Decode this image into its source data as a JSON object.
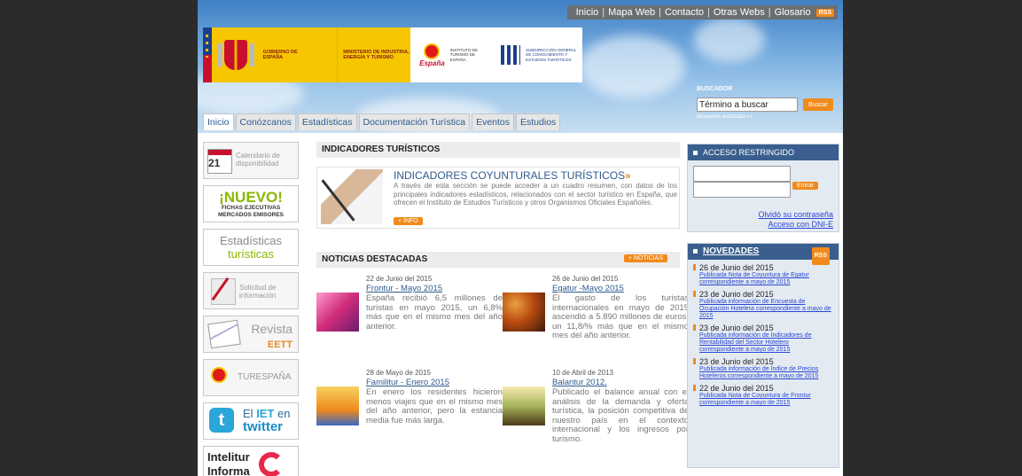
{
  "topbar": {
    "links": [
      "Inicio",
      "Mapa Web",
      "Contacto",
      "Otras Webs",
      "Glosario"
    ],
    "rss": "RSS"
  },
  "header": {
    "gobierno": "GOBIERNO DE ESPAÑA",
    "ministerio": "MINISTERIO DE INDUSTRIA, ENERGÍA Y TURISMO",
    "instituto": "INSTITUTO DE TURISMO DE ESPAÑA",
    "espana_logo": "España",
    "subdireccion": "SUBDIRECCIÓN GENERAL DE CONOCIMIENTO Y ESTUDIOS TURÍSTICOS"
  },
  "search": {
    "label": "BUSCADOR",
    "value": "Término a buscar",
    "button": "Buscar",
    "advanced": "Búsqueda avanzada >>"
  },
  "nav": {
    "tabs": [
      "Inicio",
      "Conózcanos",
      "Estadísticas",
      "Documentación Turística",
      "Eventos",
      "Estudios"
    ]
  },
  "left": {
    "calendar_day": "21",
    "calendar_label": "Calendario de disponibilidad",
    "nuevo": "¡NUEVO!",
    "nuevo_sub1": "FICHAS EJECUTIVAS",
    "nuevo_sub2": "MERCADOS EMISORES",
    "estad_a": "Estadísticas",
    "estad_b": "turísticas",
    "solicitud": "Solicitud de información",
    "revista": "Revista",
    "revista_b": "EETT",
    "turespana": "TURESPAÑA",
    "twitter_a": "El",
    "twitter_b": "IET",
    "twitter_c": "en",
    "twitter_d": "twitter",
    "intelitur": "Intelitur Informa"
  },
  "indicadores": {
    "section_title": "INDICADORES TURÍSTICOS",
    "title": "INDICADORES COYUNTURALES TURÍSTICOS",
    "text": "A través de esta sección se puede acceder a un cuadro resumen, con datos de los principales indicadores estadísticos, relacionados con el sector turístico en España, que ofrecen el Instituto de Estudios Turísticos y otros Organismos Oficiales Españoles.",
    "info_button": "+ INFO"
  },
  "noticias": {
    "section_title": "NOTICIAS DESTACADAS",
    "more_button": "+ NOTICIAS",
    "items": [
      {
        "date": "22 de Junio del 2015",
        "title": "Frontur - Mayo 2015",
        "text": "España recibió 6,5 millones de turistas en mayo 2015, un 6,8% más que en el mismo mes del año anterior."
      },
      {
        "date": "26 de Junio del 2015",
        "title": "Egatur -Mayo 2015",
        "text": "El gasto de los turistas internacionales en mayo de 2015 ascendió a 5.890 millones de euros, un 11,8/% más que en el mismo mes del año anterior."
      },
      {
        "date": "28 de Mayo de 2015",
        "title": "Familitur - Enero 2015",
        "text": "En enero los residentes hicieron menos viajes que en el mismo mes del año anterior, pero la estancia media fue más larga."
      },
      {
        "date": "10 de Abril de 2013",
        "title": "Balantur 2012.",
        "text": "Publicado el balance anual con el análisis de la demanda y oferta turística, la posición competitiva de nuestro país en el contexto internacional y los ingresos por turismo."
      }
    ]
  },
  "acceso": {
    "title": "ACCESO RESTRINGIDO",
    "button": "Entrar",
    "forgot": "Olvidó su contraseña",
    "dni": "Acceso con DNI-E"
  },
  "novedades": {
    "title": "NOVEDADES",
    "rss": "RSS",
    "items": [
      {
        "date": "26 de Junio del 2015",
        "link": "Publicada Nota de Coyuntura de Egatur correspondiente a mayo de 2015"
      },
      {
        "date": "23 de Junio del 2015",
        "link": "Publicada información de Encuesta de Ocupación Hotelera correspondiente a mayo de 2015"
      },
      {
        "date": "23 de Junio del 2015",
        "link": "Publicada información de Indicadores de Rentabilidad del Sector Hotelero correspondiente a mayo de 2015"
      },
      {
        "date": "23 de Junio del 2015",
        "link": "Publicada información de Índice de Precios Hoteleros correspondiente a mayo de 2015"
      },
      {
        "date": "22 de Junio del 2015",
        "link": "Publicada Nota de Coyuntura de Frontur correspondiente a mayo de 2015"
      }
    ]
  }
}
